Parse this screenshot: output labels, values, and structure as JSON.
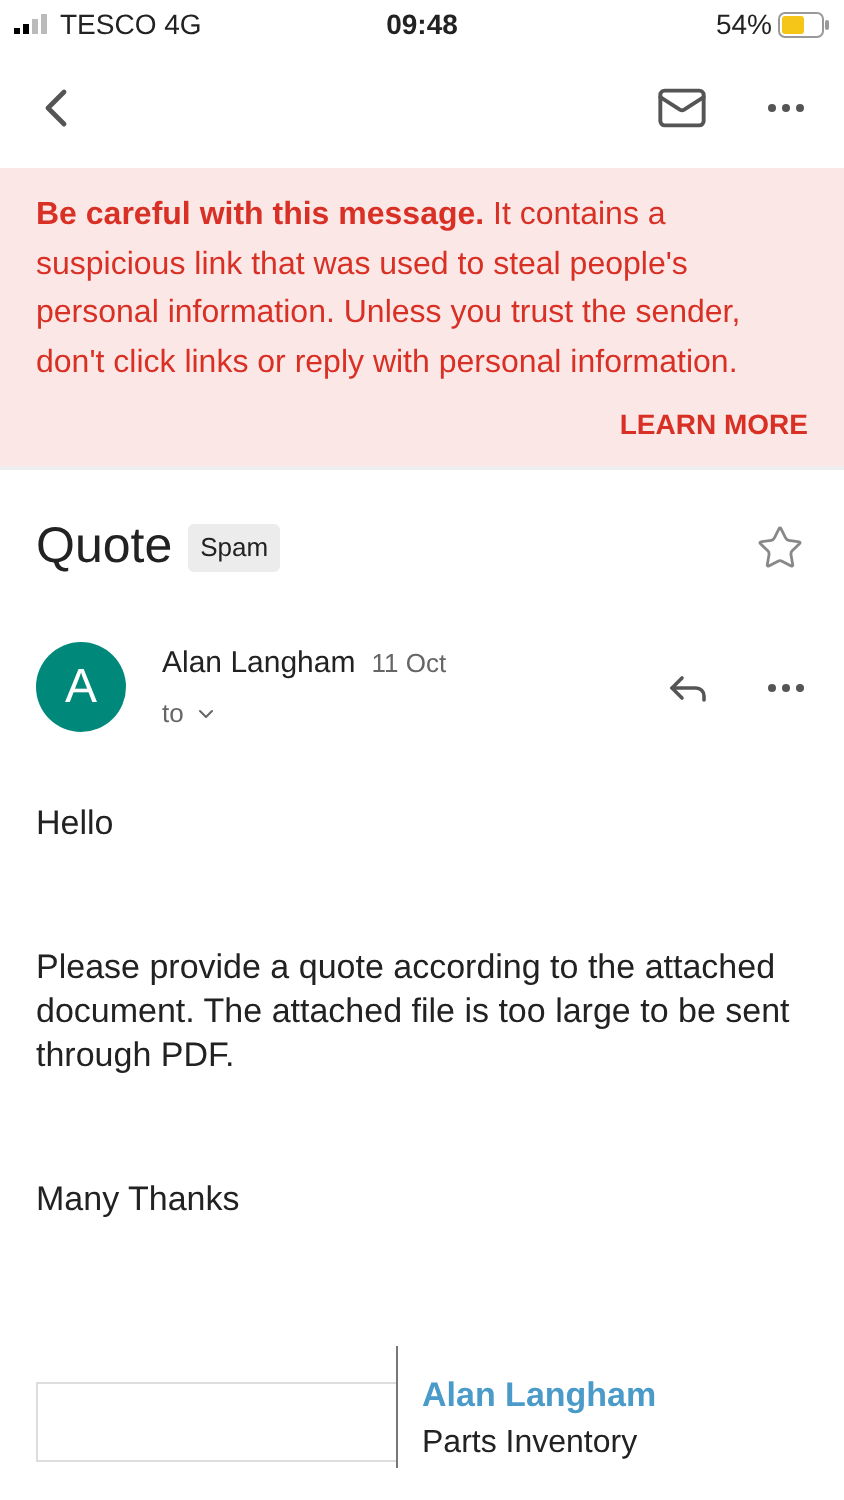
{
  "status_bar": {
    "carrier": "TESCO 4G",
    "time": "09:48",
    "battery": "54%"
  },
  "warning": {
    "message": "**Be careful with this message.** It contains a suspicious link that was used to steal people's personal information. Unless you trust the sender, don't click links or reply with personal information.",
    "action": "LEARN MORE"
  },
  "subject": {
    "title": "Quote",
    "label": "Spam",
    "starred": false
  },
  "sender": {
    "initial": "A",
    "name": "Alan Langham",
    "date": "11 Oct",
    "recipient": "to"
  },
  "body": [
    "Hello",
    "Please provide a quote according to the attached document. The attached file is too large to be sent through PDF.",
    "Many Thanks"
  ],
  "signature": {
    "name": "Alan Langham",
    "department": "Parts Inventory"
  }
}
